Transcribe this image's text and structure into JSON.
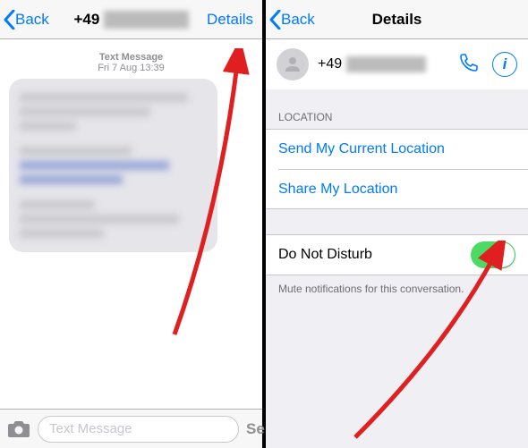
{
  "left": {
    "back": "Back",
    "title_prefix": "+49 ",
    "details": "Details",
    "msg_type": "Text Message",
    "msg_time": "Fri 7 Aug 13:39",
    "input_placeholder": "Text Message",
    "send": "Send"
  },
  "right": {
    "back": "Back",
    "title": "Details",
    "contact_prefix": "+49 ",
    "section_location": "LOCATION",
    "send_location": "Send My Current Location",
    "share_location": "Share My Location",
    "dnd": "Do Not Disturb",
    "dnd_hint": "Mute notifications for this conversation."
  },
  "colors": {
    "tint": "#007aff",
    "toggle_on": "#4cd964"
  }
}
